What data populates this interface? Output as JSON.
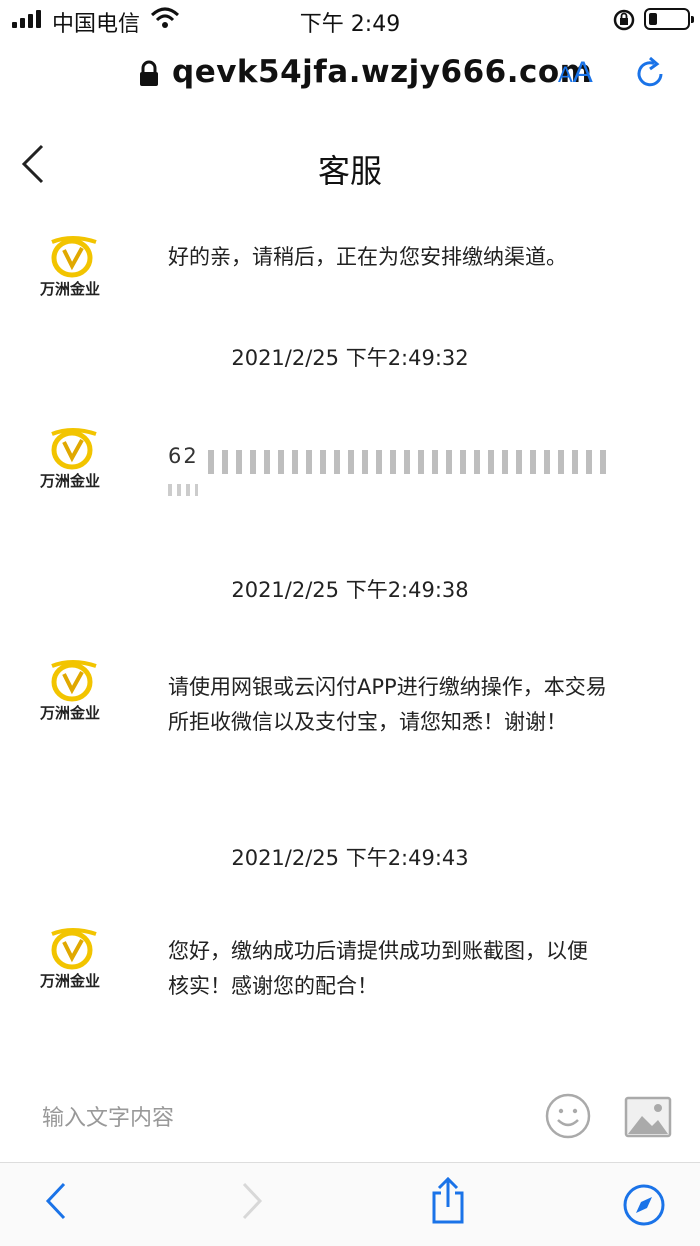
{
  "status_bar": {
    "carrier": "中国电信",
    "time": "下午 2:49"
  },
  "url_bar": {
    "url": "qevk54jfa.wzjy666.com",
    "text_size_label_small": "A",
    "text_size_label_big": "A"
  },
  "header": {
    "title": "客服"
  },
  "avatar": {
    "logo_text": "万洲金业"
  },
  "messages": [
    {
      "type": "message",
      "text": "好的亲，请稍后，正在为您安排缴纳渠道。"
    },
    {
      "type": "timestamp",
      "text": "2021/2/25 下午2:49:32"
    },
    {
      "type": "redacted",
      "visible_prefix": "62"
    },
    {
      "type": "timestamp",
      "text": "2021/2/25 下午2:49:38"
    },
    {
      "type": "message",
      "text": "请使用网银或云闪付APP进行缴纳操作，本交易所拒收微信以及支付宝，请您知悉！谢谢！"
    },
    {
      "type": "timestamp",
      "text": "2021/2/25 下午2:49:43"
    },
    {
      "type": "message",
      "text": "您好，缴纳成功后请提供成功到账截图，以便核实！感谢您的配合！"
    }
  ],
  "input": {
    "placeholder": "输入文字内容"
  },
  "colors": {
    "accent": "#1a73e8",
    "logo_gold": "#f2c400"
  }
}
